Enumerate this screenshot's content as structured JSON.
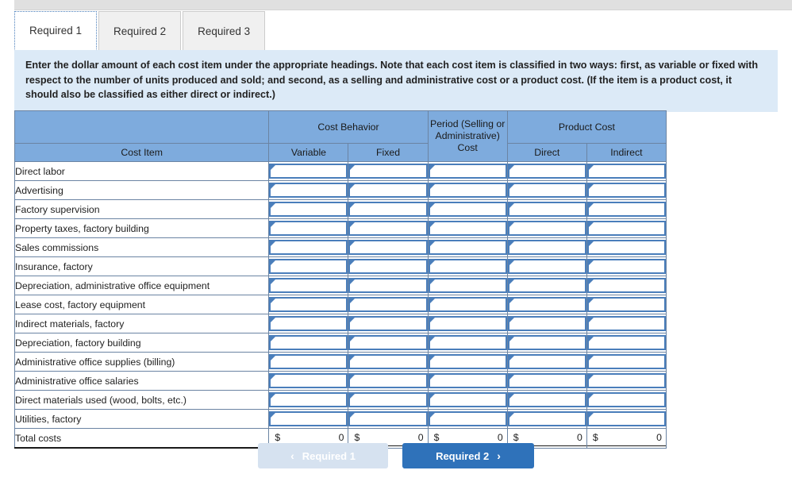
{
  "tabs": [
    {
      "label": "Required 1",
      "active": true
    },
    {
      "label": "Required 2",
      "active": false
    },
    {
      "label": "Required 3",
      "active": false
    }
  ],
  "instructions": {
    "text": "Enter the dollar amount of each cost item under the appropriate headings. Note that each cost item is classified in two ways: first, as variable or fixed with respect to the number of units produced and sold; and second, as a selling and administrative cost or a product cost. (If the item is a product cost, it should also be classified as either direct or indirect.)"
  },
  "table": {
    "group_headers": {
      "cost_item": "",
      "cost_behavior": "Cost Behavior",
      "period_cost": "Period (Selling or Administrative) Cost",
      "product_cost": "Product Cost"
    },
    "column_headers": {
      "cost_item": "Cost Item",
      "variable": "Variable",
      "fixed": "Fixed",
      "direct": "Direct",
      "indirect": "Indirect"
    },
    "rows": [
      {
        "label": "Direct labor",
        "variable": "",
        "fixed": "",
        "period": "",
        "direct": "",
        "indirect": ""
      },
      {
        "label": "Advertising",
        "variable": "",
        "fixed": "",
        "period": "",
        "direct": "",
        "indirect": ""
      },
      {
        "label": "Factory supervision",
        "variable": "",
        "fixed": "",
        "period": "",
        "direct": "",
        "indirect": ""
      },
      {
        "label": "Property taxes, factory building",
        "variable": "",
        "fixed": "",
        "period": "",
        "direct": "",
        "indirect": ""
      },
      {
        "label": "Sales commissions",
        "variable": "",
        "fixed": "",
        "period": "",
        "direct": "",
        "indirect": ""
      },
      {
        "label": "Insurance, factory",
        "variable": "",
        "fixed": "",
        "period": "",
        "direct": "",
        "indirect": ""
      },
      {
        "label": "Depreciation, administrative office equipment",
        "variable": "",
        "fixed": "",
        "period": "",
        "direct": "",
        "indirect": ""
      },
      {
        "label": "Lease cost, factory equipment",
        "variable": "",
        "fixed": "",
        "period": "",
        "direct": "",
        "indirect": ""
      },
      {
        "label": "Indirect materials, factory",
        "variable": "",
        "fixed": "",
        "period": "",
        "direct": "",
        "indirect": ""
      },
      {
        "label": "Depreciation, factory building",
        "variable": "",
        "fixed": "",
        "period": "",
        "direct": "",
        "indirect": ""
      },
      {
        "label": "Administrative office supplies (billing)",
        "variable": "",
        "fixed": "",
        "period": "",
        "direct": "",
        "indirect": ""
      },
      {
        "label": "Administrative office salaries",
        "variable": "",
        "fixed": "",
        "period": "",
        "direct": "",
        "indirect": ""
      },
      {
        "label": "Direct materials used (wood, bolts, etc.)",
        "variable": "",
        "fixed": "",
        "period": "",
        "direct": "",
        "indirect": ""
      },
      {
        "label": "Utilities, factory",
        "variable": "",
        "fixed": "",
        "period": "",
        "direct": "",
        "indirect": ""
      }
    ],
    "total_row": {
      "label": "Total costs",
      "currency": "$",
      "values": [
        "0",
        "0",
        "0",
        "0",
        "0"
      ]
    }
  },
  "footer": {
    "prev_button": {
      "label": "Required 1",
      "icon": "chevron-left",
      "glyph": "‹",
      "disabled": true
    },
    "next_button": {
      "label": "Required 2",
      "icon": "chevron-right",
      "glyph": "›",
      "disabled": false
    }
  },
  "colors": {
    "header_blue": "#7eabdd",
    "info_panel": "#dceaf7",
    "input_border": "#4a7ebb",
    "next_button": "#2f72ba",
    "prev_button": "#d6e2f0",
    "top_strip": "#e0e0e0"
  }
}
